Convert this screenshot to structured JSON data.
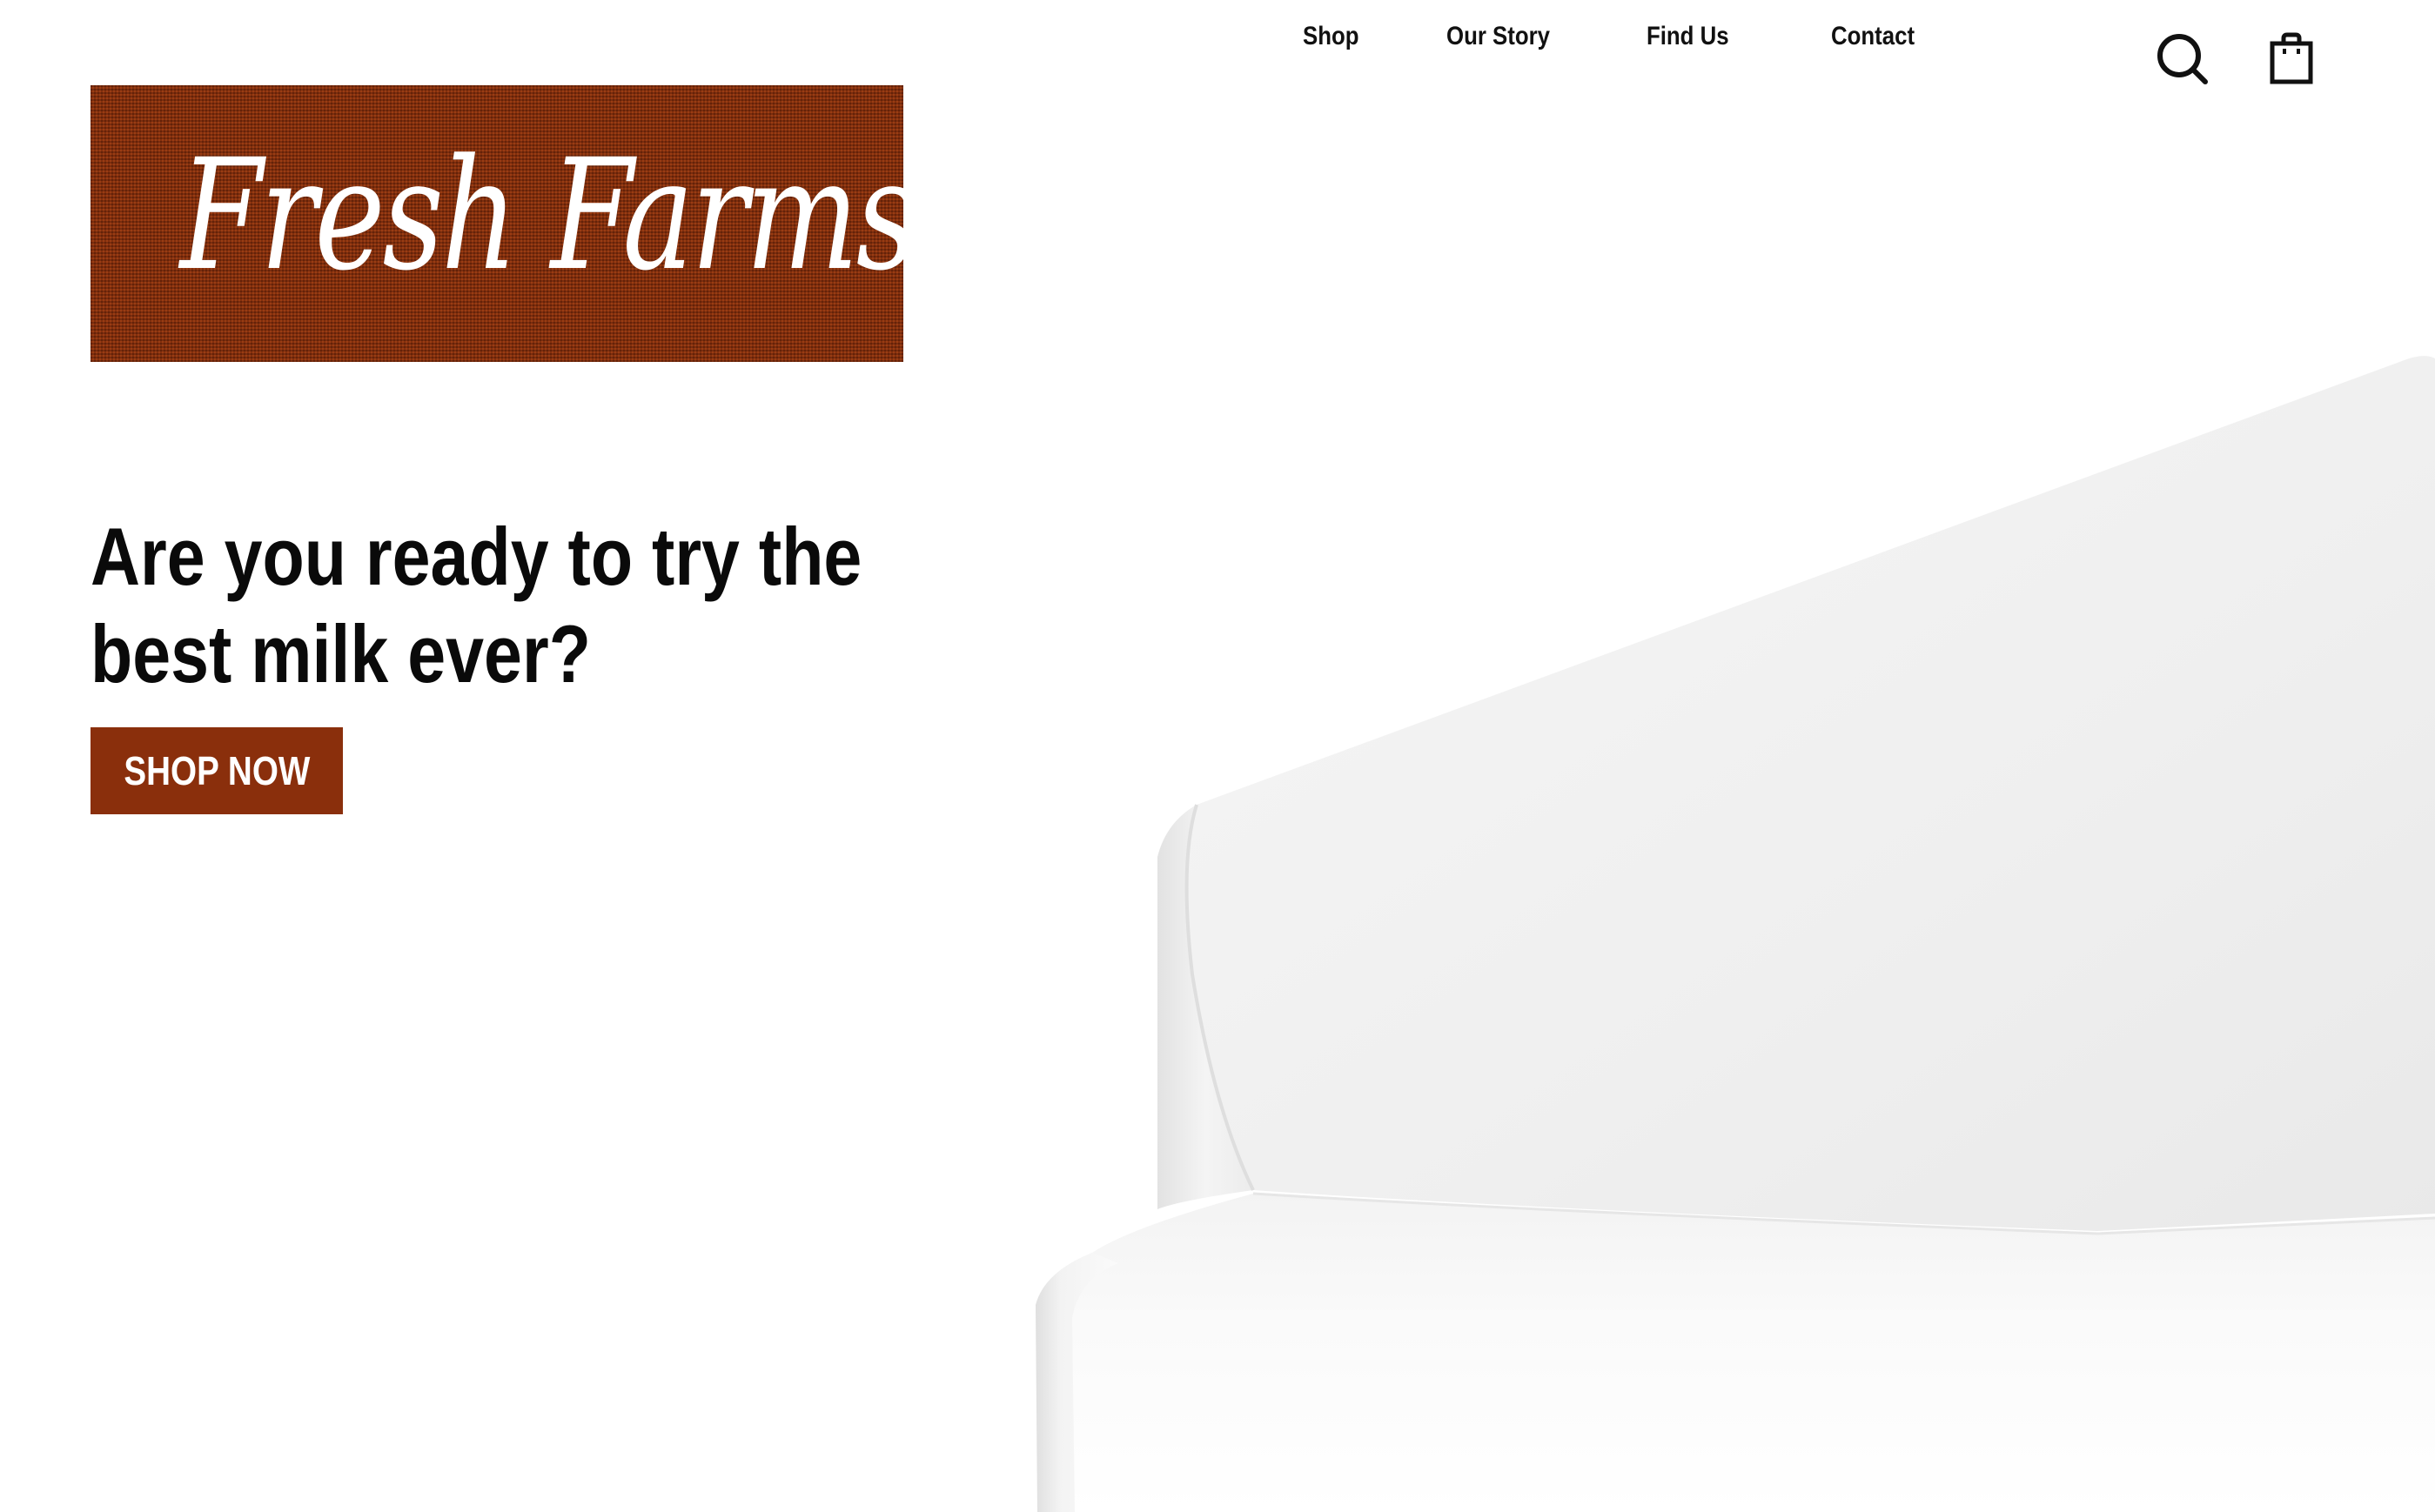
{
  "header": {
    "nav": [
      {
        "label": "Shop"
      },
      {
        "label": "Our Story"
      },
      {
        "label": "Find Us"
      },
      {
        "label": "Contact"
      }
    ],
    "icons": {
      "search": "search-icon",
      "cart": "shopping-bag-icon"
    }
  },
  "logo": {
    "text": "Fresh Farms"
  },
  "hero": {
    "headline": "Are you ready to try the best milk ever?",
    "cta_label": "SHOP NOW"
  },
  "colors": {
    "brand": "#8a2f0c",
    "text": "#0a0a0a",
    "background": "#ffffff"
  }
}
